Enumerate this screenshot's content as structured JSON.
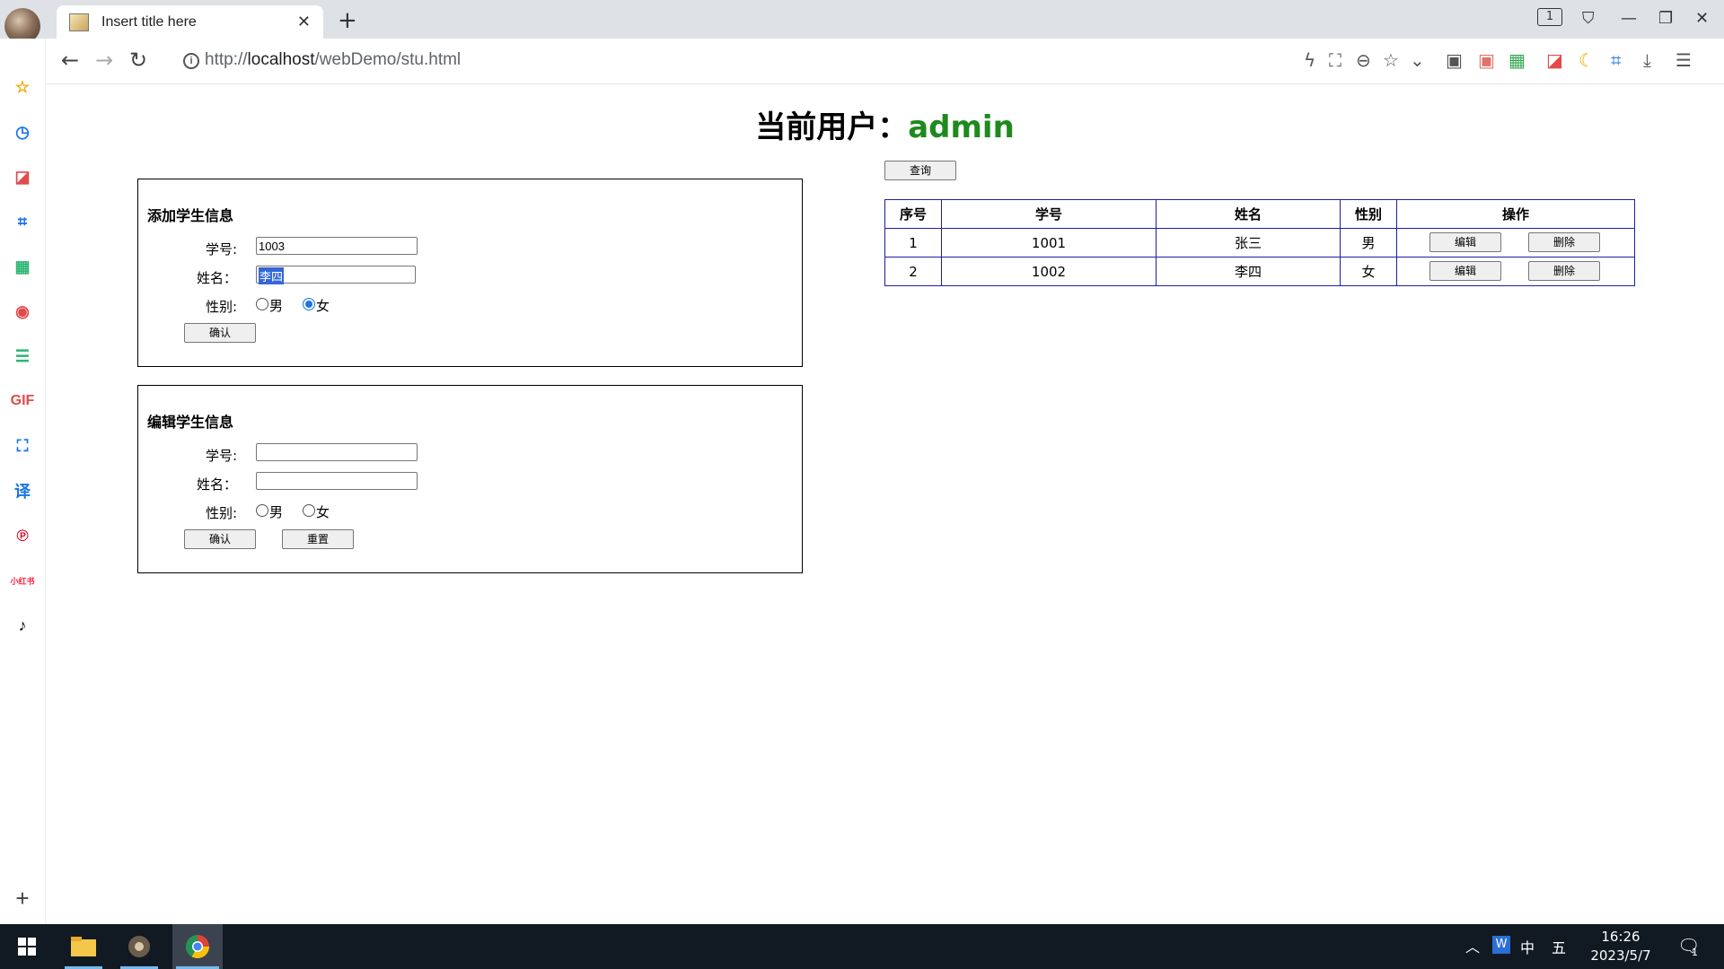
{
  "browser": {
    "tab_title": "Insert title here",
    "tab_close": "✕",
    "new_tab": "+",
    "url_prefix": "http://",
    "url_host": "localhost",
    "url_path": "/webDemo/stu.html",
    "tab_count": "1",
    "window_controls": {
      "minimize": "—",
      "restore": "❐",
      "close": "✕"
    }
  },
  "sidebar": {
    "items": [
      {
        "icon": "star-icon",
        "glyph": "☆",
        "color": "#f2a600"
      },
      {
        "icon": "history-clock-icon",
        "glyph": "◷",
        "color": "#1a73e8"
      },
      {
        "icon": "pdf-icon",
        "glyph": "◪",
        "color": "#e24a4a"
      },
      {
        "icon": "crop-icon",
        "glyph": "⌗",
        "color": "#1a73e8"
      },
      {
        "icon": "qr-code-icon",
        "glyph": "▦",
        "color": "#2bb673"
      },
      {
        "icon": "record-icon",
        "glyph": "◉",
        "color": "#e24a4a"
      },
      {
        "icon": "notes-icon",
        "glyph": "☰",
        "color": "#2bb673"
      },
      {
        "icon": "gif-icon",
        "glyph": "GIF",
        "color": "#e24a4a"
      },
      {
        "icon": "scan-icon",
        "glyph": "⛶",
        "color": "#1a73e8"
      },
      {
        "icon": "translate-icon",
        "glyph": "译",
        "color": "#1a73e8"
      },
      {
        "icon": "pinterest-icon",
        "glyph": "℗",
        "color": "#e60023"
      },
      {
        "icon": "xiaohongshu-icon",
        "glyph": "小红书",
        "color": "#ff2442"
      },
      {
        "icon": "tiktok-icon",
        "glyph": "♪",
        "color": "#000000"
      }
    ],
    "add": "+"
  },
  "page": {
    "heading_label": "当前用户：",
    "username": "admin",
    "username_color": "#1d8a1d",
    "add_panel": {
      "title": "添加学生信息",
      "id_label": "学号:",
      "id_value": "1003",
      "name_label": "姓名：",
      "name_value": "李四",
      "gender_label": "性别:",
      "male": "男",
      "female": "女",
      "selected": "女",
      "confirm": "确认"
    },
    "edit_panel": {
      "title": "编辑学生信息",
      "id_label": "学号:",
      "id_value": "",
      "name_label": "姓名：",
      "name_value": "",
      "gender_label": "性别:",
      "male": "男",
      "female": "女",
      "confirm": "确认",
      "reset": "重置"
    },
    "query_button": "查询",
    "table": {
      "headers": [
        "序号",
        "学号",
        "姓名",
        "性别",
        "操作"
      ],
      "rows": [
        {
          "seq": "1",
          "id": "1001",
          "name": "张三",
          "gender": "男"
        },
        {
          "seq": "2",
          "id": "1002",
          "name": "李四",
          "gender": "女"
        }
      ],
      "edit_label": "编辑",
      "delete_label": "删除"
    }
  },
  "taskbar": {
    "time": "16:26",
    "date": "2023/5/7",
    "ime_lang": "中",
    "ime_mode": "五",
    "notification_count": "1"
  }
}
